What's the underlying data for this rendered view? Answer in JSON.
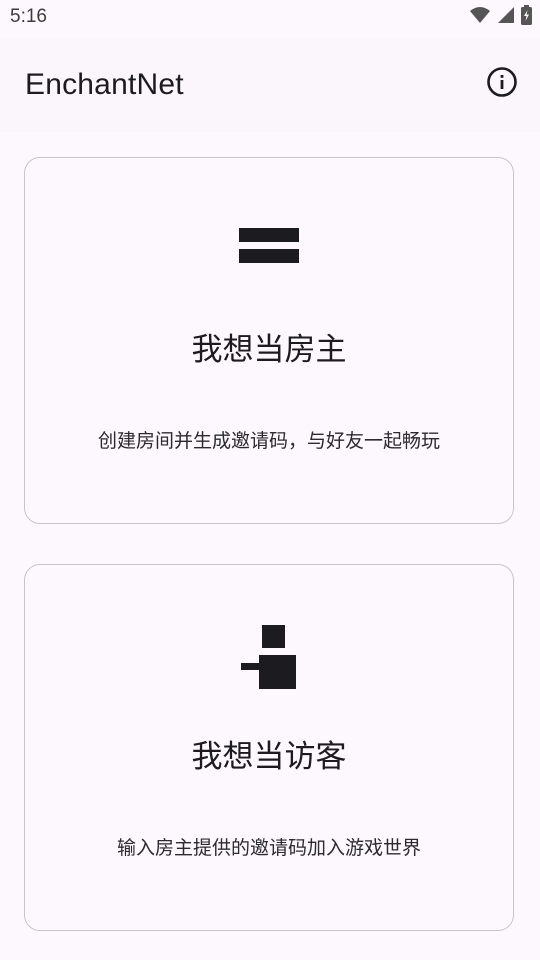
{
  "status_bar": {
    "time": "5:16",
    "icons": [
      "wifi-icon",
      "cellular-icon",
      "battery-charging-icon"
    ]
  },
  "app_bar": {
    "title": "EnchantNet",
    "action_icon": "info-icon"
  },
  "cards": {
    "host": {
      "icon": "host-icon",
      "title": "我想当房主",
      "description": "创建房间并生成邀请码，与好友一起畅玩"
    },
    "guest": {
      "icon": "guest-icon",
      "title": "我想当访客",
      "description": "输入房主提供的邀请码加入游戏世界"
    }
  },
  "colors": {
    "background": "#fdf8fd",
    "app_bar": "#fbf6fb",
    "text": "#1c1b1f",
    "card_border": "#c8c5ca"
  }
}
